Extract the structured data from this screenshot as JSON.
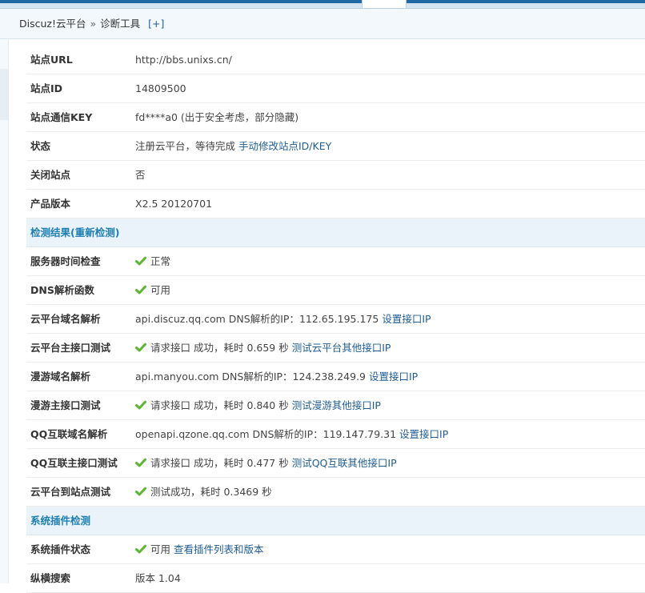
{
  "breadcrumb": {
    "root": "Discuz!云平台",
    "separator": "»",
    "current": "诊断工具",
    "add": "[+]"
  },
  "rows": [
    {
      "label": "站点URL",
      "value": "http://bbs.unixs.cn/"
    },
    {
      "label": "站点ID",
      "value": "14809500"
    },
    {
      "label": "站点通信KEY",
      "value": "fd****a0 (出于安全考虑，部分隐藏)"
    },
    {
      "label": "状态",
      "value": "注册云平台，等待完成",
      "link": "手动修改站点ID/KEY"
    },
    {
      "label": "关闭站点",
      "value": "否"
    },
    {
      "label": "产品版本",
      "value": "X2.5 20120701"
    }
  ],
  "section1": {
    "title": "检测结果(重新检测)"
  },
  "checks": [
    {
      "label": "服务器时间检查",
      "icon": "check-icon",
      "value": "正常"
    },
    {
      "label": "DNS解析函数",
      "icon": "check-icon",
      "value": "可用"
    },
    {
      "label": "云平台域名解析",
      "value": "api.discuz.qq.com DNS解析的IP：112.65.195.175",
      "link": "设置接口IP"
    },
    {
      "label": "云平台主接口测试",
      "icon": "check-icon",
      "value": "请求接口 成功，耗时 0.659 秒",
      "link": "测试云平台其他接口IP"
    },
    {
      "label": "漫游域名解析",
      "value": "api.manyou.com DNS解析的IP：124.238.249.9",
      "link": "设置接口IP"
    },
    {
      "label": "漫游主接口测试",
      "icon": "check-icon",
      "value": "请求接口 成功，耗时 0.840 秒",
      "link": "测试漫游其他接口IP"
    },
    {
      "label": "QQ互联域名解析",
      "value": "openapi.qzone.qq.com DNS解析的IP：119.147.79.31",
      "link": "设置接口IP"
    },
    {
      "label": "QQ互联主接口测试",
      "icon": "check-icon",
      "value": "请求接口 成功，耗时 0.477 秒",
      "link": "测试QQ互联其他接口IP"
    },
    {
      "label": "云平台到站点测试",
      "icon": "check-icon",
      "value": "测试成功，耗时 0.3469 秒"
    }
  ],
  "section2": {
    "title": "系统插件检测"
  },
  "plugins": [
    {
      "label": "系统插件状态",
      "icon": "check-icon",
      "value": "可用",
      "link": "查看插件列表和版本"
    },
    {
      "label": "纵横搜索",
      "value": "版本 1.04"
    }
  ],
  "colors": {
    "header_text": "#1d7fb3",
    "link": "#1f5d94",
    "check_green": "#5bb82e",
    "top_strip": "#1f6aa5"
  }
}
